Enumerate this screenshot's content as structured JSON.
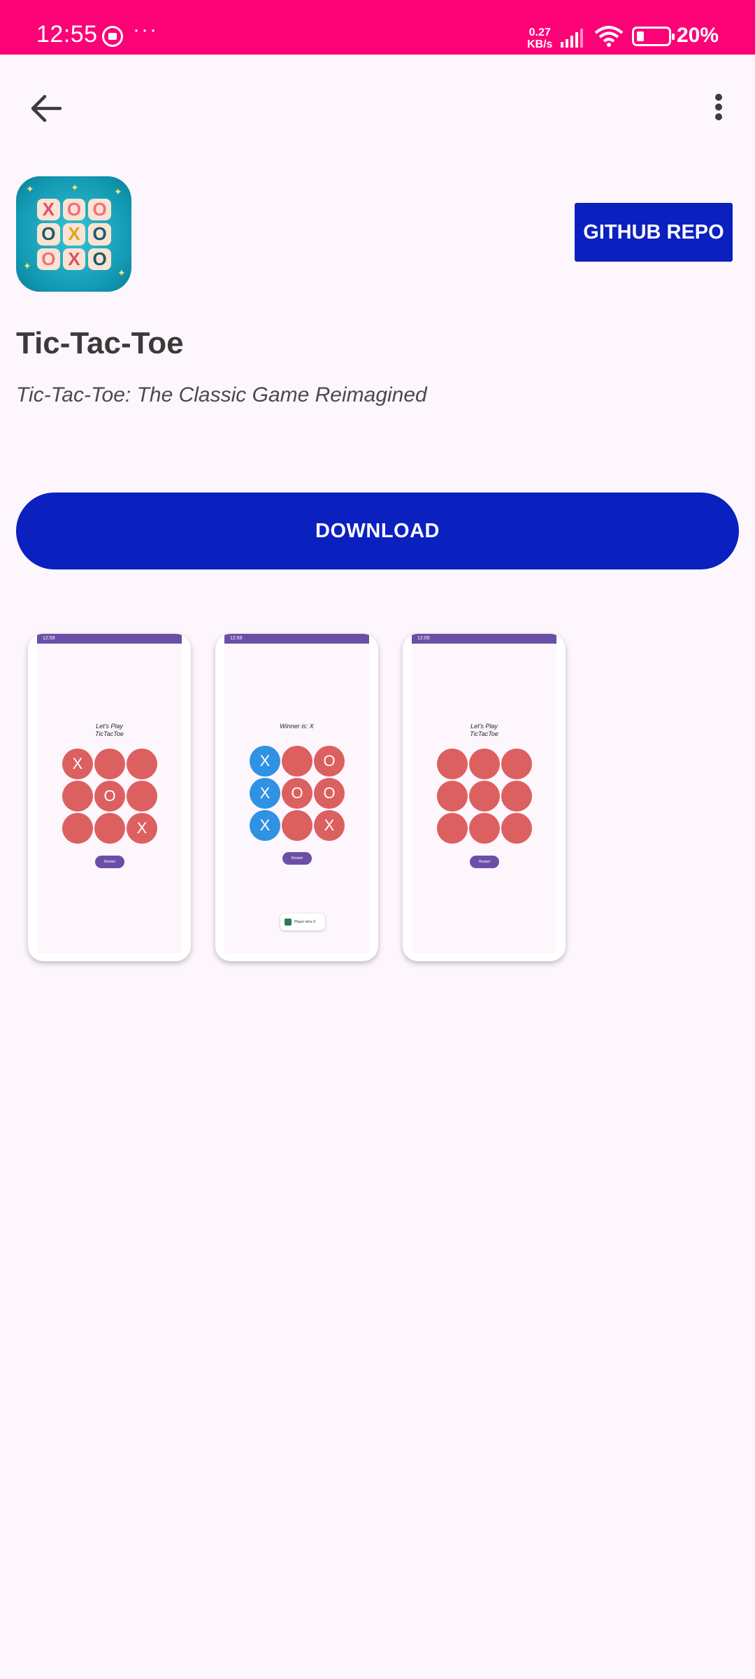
{
  "status_bar": {
    "time": "12:55",
    "more": "···",
    "speed_value": "0.27",
    "speed_unit": "KB/s",
    "battery_pct": "20%",
    "icons": [
      "notification-icon",
      "signal-icon",
      "wifi-icon",
      "battery-icon"
    ]
  },
  "toolbar": {
    "back_icon": "arrow-left-icon",
    "menu_icon": "more-vert-icon"
  },
  "app": {
    "title": "Tic-Tac-Toe",
    "subtitle": "Tic-Tac-Toe: The Classic Game Reimagined",
    "github_label": "GITHUB REPO",
    "download_label": "DOWNLOAD",
    "icon_cells": [
      "X",
      "O",
      "O",
      "O",
      "X",
      "O",
      "O",
      "X",
      "O"
    ]
  },
  "screenshots": [
    {
      "status_time": "12:59",
      "title": "Let's Play\nTicTacToe",
      "cells": [
        "X",
        "",
        "",
        "",
        "O",
        "",
        "",
        "",
        "X"
      ],
      "blue_cells": [],
      "restart_label": "Restart",
      "toast": ""
    },
    {
      "status_time": "12:59",
      "title": "Winner is: X",
      "cells": [
        "X",
        "",
        "O",
        "X",
        "O",
        "O",
        "X",
        "",
        "X"
      ],
      "blue_cells": [
        0,
        3,
        6
      ],
      "restart_label": "Restart",
      "toast": "Player wins X"
    },
    {
      "status_time": "12:05",
      "title": "Let's Play\nTicTacToe",
      "cells": [
        "",
        "",
        "",
        "",
        "",
        "",
        "",
        "",
        ""
      ],
      "blue_cells": [],
      "restart_label": "Restart",
      "toast": ""
    }
  ],
  "colors": {
    "status_bar": "#fd0277",
    "primary_button": "#0a20bf",
    "background": "#fdf6fd",
    "cell_red": "#dc6060",
    "cell_blue": "#2f92e3",
    "mini_bar": "#6b4fa7"
  }
}
